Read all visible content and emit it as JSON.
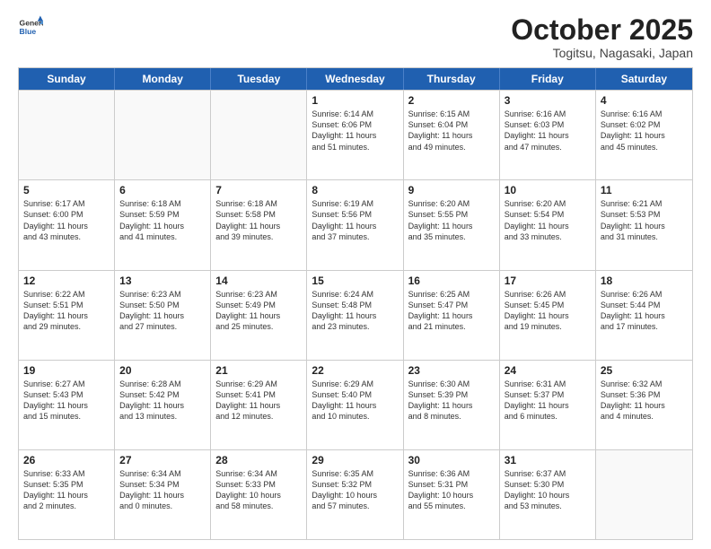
{
  "header": {
    "logo_line1": "General",
    "logo_line2": "Blue",
    "month_title": "October 2025",
    "location": "Togitsu, Nagasaki, Japan"
  },
  "weekdays": [
    "Sunday",
    "Monday",
    "Tuesday",
    "Wednesday",
    "Thursday",
    "Friday",
    "Saturday"
  ],
  "rows": [
    [
      {
        "day": "",
        "text": ""
      },
      {
        "day": "",
        "text": ""
      },
      {
        "day": "",
        "text": ""
      },
      {
        "day": "1",
        "text": "Sunrise: 6:14 AM\nSunset: 6:06 PM\nDaylight: 11 hours\nand 51 minutes."
      },
      {
        "day": "2",
        "text": "Sunrise: 6:15 AM\nSunset: 6:04 PM\nDaylight: 11 hours\nand 49 minutes."
      },
      {
        "day": "3",
        "text": "Sunrise: 6:16 AM\nSunset: 6:03 PM\nDaylight: 11 hours\nand 47 minutes."
      },
      {
        "day": "4",
        "text": "Sunrise: 6:16 AM\nSunset: 6:02 PM\nDaylight: 11 hours\nand 45 minutes."
      }
    ],
    [
      {
        "day": "5",
        "text": "Sunrise: 6:17 AM\nSunset: 6:00 PM\nDaylight: 11 hours\nand 43 minutes."
      },
      {
        "day": "6",
        "text": "Sunrise: 6:18 AM\nSunset: 5:59 PM\nDaylight: 11 hours\nand 41 minutes."
      },
      {
        "day": "7",
        "text": "Sunrise: 6:18 AM\nSunset: 5:58 PM\nDaylight: 11 hours\nand 39 minutes."
      },
      {
        "day": "8",
        "text": "Sunrise: 6:19 AM\nSunset: 5:56 PM\nDaylight: 11 hours\nand 37 minutes."
      },
      {
        "day": "9",
        "text": "Sunrise: 6:20 AM\nSunset: 5:55 PM\nDaylight: 11 hours\nand 35 minutes."
      },
      {
        "day": "10",
        "text": "Sunrise: 6:20 AM\nSunset: 5:54 PM\nDaylight: 11 hours\nand 33 minutes."
      },
      {
        "day": "11",
        "text": "Sunrise: 6:21 AM\nSunset: 5:53 PM\nDaylight: 11 hours\nand 31 minutes."
      }
    ],
    [
      {
        "day": "12",
        "text": "Sunrise: 6:22 AM\nSunset: 5:51 PM\nDaylight: 11 hours\nand 29 minutes."
      },
      {
        "day": "13",
        "text": "Sunrise: 6:23 AM\nSunset: 5:50 PM\nDaylight: 11 hours\nand 27 minutes."
      },
      {
        "day": "14",
        "text": "Sunrise: 6:23 AM\nSunset: 5:49 PM\nDaylight: 11 hours\nand 25 minutes."
      },
      {
        "day": "15",
        "text": "Sunrise: 6:24 AM\nSunset: 5:48 PM\nDaylight: 11 hours\nand 23 minutes."
      },
      {
        "day": "16",
        "text": "Sunrise: 6:25 AM\nSunset: 5:47 PM\nDaylight: 11 hours\nand 21 minutes."
      },
      {
        "day": "17",
        "text": "Sunrise: 6:26 AM\nSunset: 5:45 PM\nDaylight: 11 hours\nand 19 minutes."
      },
      {
        "day": "18",
        "text": "Sunrise: 6:26 AM\nSunset: 5:44 PM\nDaylight: 11 hours\nand 17 minutes."
      }
    ],
    [
      {
        "day": "19",
        "text": "Sunrise: 6:27 AM\nSunset: 5:43 PM\nDaylight: 11 hours\nand 15 minutes."
      },
      {
        "day": "20",
        "text": "Sunrise: 6:28 AM\nSunset: 5:42 PM\nDaylight: 11 hours\nand 13 minutes."
      },
      {
        "day": "21",
        "text": "Sunrise: 6:29 AM\nSunset: 5:41 PM\nDaylight: 11 hours\nand 12 minutes."
      },
      {
        "day": "22",
        "text": "Sunrise: 6:29 AM\nSunset: 5:40 PM\nDaylight: 11 hours\nand 10 minutes."
      },
      {
        "day": "23",
        "text": "Sunrise: 6:30 AM\nSunset: 5:39 PM\nDaylight: 11 hours\nand 8 minutes."
      },
      {
        "day": "24",
        "text": "Sunrise: 6:31 AM\nSunset: 5:37 PM\nDaylight: 11 hours\nand 6 minutes."
      },
      {
        "day": "25",
        "text": "Sunrise: 6:32 AM\nSunset: 5:36 PM\nDaylight: 11 hours\nand 4 minutes."
      }
    ],
    [
      {
        "day": "26",
        "text": "Sunrise: 6:33 AM\nSunset: 5:35 PM\nDaylight: 11 hours\nand 2 minutes."
      },
      {
        "day": "27",
        "text": "Sunrise: 6:34 AM\nSunset: 5:34 PM\nDaylight: 11 hours\nand 0 minutes."
      },
      {
        "day": "28",
        "text": "Sunrise: 6:34 AM\nSunset: 5:33 PM\nDaylight: 10 hours\nand 58 minutes."
      },
      {
        "day": "29",
        "text": "Sunrise: 6:35 AM\nSunset: 5:32 PM\nDaylight: 10 hours\nand 57 minutes."
      },
      {
        "day": "30",
        "text": "Sunrise: 6:36 AM\nSunset: 5:31 PM\nDaylight: 10 hours\nand 55 minutes."
      },
      {
        "day": "31",
        "text": "Sunrise: 6:37 AM\nSunset: 5:30 PM\nDaylight: 10 hours\nand 53 minutes."
      },
      {
        "day": "",
        "text": ""
      }
    ]
  ]
}
